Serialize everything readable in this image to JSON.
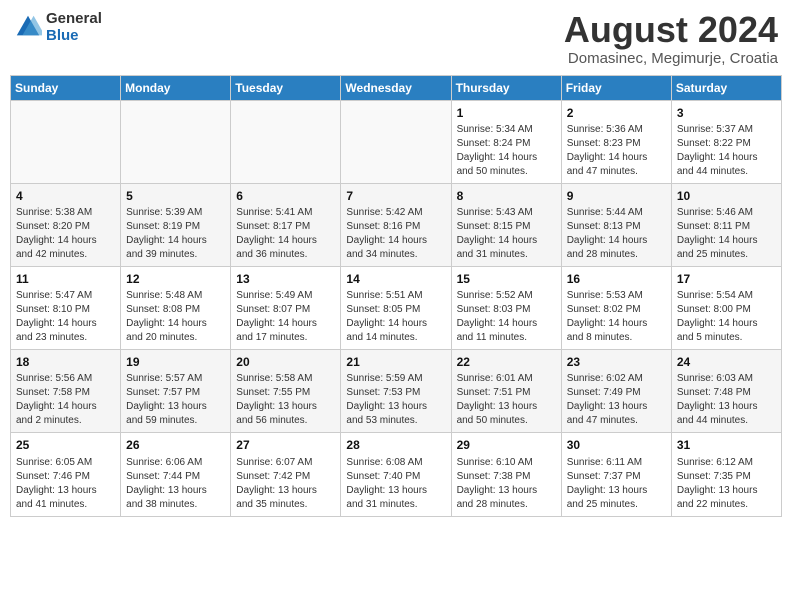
{
  "header": {
    "logo": {
      "general": "General",
      "blue": "Blue"
    },
    "title": "August 2024",
    "subtitle": "Domasinec, Megimurje, Croatia"
  },
  "weekdays": [
    "Sunday",
    "Monday",
    "Tuesday",
    "Wednesday",
    "Thursday",
    "Friday",
    "Saturday"
  ],
  "weeks": [
    [
      {
        "day": "",
        "info": ""
      },
      {
        "day": "",
        "info": ""
      },
      {
        "day": "",
        "info": ""
      },
      {
        "day": "",
        "info": ""
      },
      {
        "day": "1",
        "info": "Sunrise: 5:34 AM\nSunset: 8:24 PM\nDaylight: 14 hours\nand 50 minutes."
      },
      {
        "day": "2",
        "info": "Sunrise: 5:36 AM\nSunset: 8:23 PM\nDaylight: 14 hours\nand 47 minutes."
      },
      {
        "day": "3",
        "info": "Sunrise: 5:37 AM\nSunset: 8:22 PM\nDaylight: 14 hours\nand 44 minutes."
      }
    ],
    [
      {
        "day": "4",
        "info": "Sunrise: 5:38 AM\nSunset: 8:20 PM\nDaylight: 14 hours\nand 42 minutes."
      },
      {
        "day": "5",
        "info": "Sunrise: 5:39 AM\nSunset: 8:19 PM\nDaylight: 14 hours\nand 39 minutes."
      },
      {
        "day": "6",
        "info": "Sunrise: 5:41 AM\nSunset: 8:17 PM\nDaylight: 14 hours\nand 36 minutes."
      },
      {
        "day": "7",
        "info": "Sunrise: 5:42 AM\nSunset: 8:16 PM\nDaylight: 14 hours\nand 34 minutes."
      },
      {
        "day": "8",
        "info": "Sunrise: 5:43 AM\nSunset: 8:15 PM\nDaylight: 14 hours\nand 31 minutes."
      },
      {
        "day": "9",
        "info": "Sunrise: 5:44 AM\nSunset: 8:13 PM\nDaylight: 14 hours\nand 28 minutes."
      },
      {
        "day": "10",
        "info": "Sunrise: 5:46 AM\nSunset: 8:11 PM\nDaylight: 14 hours\nand 25 minutes."
      }
    ],
    [
      {
        "day": "11",
        "info": "Sunrise: 5:47 AM\nSunset: 8:10 PM\nDaylight: 14 hours\nand 23 minutes."
      },
      {
        "day": "12",
        "info": "Sunrise: 5:48 AM\nSunset: 8:08 PM\nDaylight: 14 hours\nand 20 minutes."
      },
      {
        "day": "13",
        "info": "Sunrise: 5:49 AM\nSunset: 8:07 PM\nDaylight: 14 hours\nand 17 minutes."
      },
      {
        "day": "14",
        "info": "Sunrise: 5:51 AM\nSunset: 8:05 PM\nDaylight: 14 hours\nand 14 minutes."
      },
      {
        "day": "15",
        "info": "Sunrise: 5:52 AM\nSunset: 8:03 PM\nDaylight: 14 hours\nand 11 minutes."
      },
      {
        "day": "16",
        "info": "Sunrise: 5:53 AM\nSunset: 8:02 PM\nDaylight: 14 hours\nand 8 minutes."
      },
      {
        "day": "17",
        "info": "Sunrise: 5:54 AM\nSunset: 8:00 PM\nDaylight: 14 hours\nand 5 minutes."
      }
    ],
    [
      {
        "day": "18",
        "info": "Sunrise: 5:56 AM\nSunset: 7:58 PM\nDaylight: 14 hours\nand 2 minutes."
      },
      {
        "day": "19",
        "info": "Sunrise: 5:57 AM\nSunset: 7:57 PM\nDaylight: 13 hours\nand 59 minutes."
      },
      {
        "day": "20",
        "info": "Sunrise: 5:58 AM\nSunset: 7:55 PM\nDaylight: 13 hours\nand 56 minutes."
      },
      {
        "day": "21",
        "info": "Sunrise: 5:59 AM\nSunset: 7:53 PM\nDaylight: 13 hours\nand 53 minutes."
      },
      {
        "day": "22",
        "info": "Sunrise: 6:01 AM\nSunset: 7:51 PM\nDaylight: 13 hours\nand 50 minutes."
      },
      {
        "day": "23",
        "info": "Sunrise: 6:02 AM\nSunset: 7:49 PM\nDaylight: 13 hours\nand 47 minutes."
      },
      {
        "day": "24",
        "info": "Sunrise: 6:03 AM\nSunset: 7:48 PM\nDaylight: 13 hours\nand 44 minutes."
      }
    ],
    [
      {
        "day": "25",
        "info": "Sunrise: 6:05 AM\nSunset: 7:46 PM\nDaylight: 13 hours\nand 41 minutes."
      },
      {
        "day": "26",
        "info": "Sunrise: 6:06 AM\nSunset: 7:44 PM\nDaylight: 13 hours\nand 38 minutes."
      },
      {
        "day": "27",
        "info": "Sunrise: 6:07 AM\nSunset: 7:42 PM\nDaylight: 13 hours\nand 35 minutes."
      },
      {
        "day": "28",
        "info": "Sunrise: 6:08 AM\nSunset: 7:40 PM\nDaylight: 13 hours\nand 31 minutes."
      },
      {
        "day": "29",
        "info": "Sunrise: 6:10 AM\nSunset: 7:38 PM\nDaylight: 13 hours\nand 28 minutes."
      },
      {
        "day": "30",
        "info": "Sunrise: 6:11 AM\nSunset: 7:37 PM\nDaylight: 13 hours\nand 25 minutes."
      },
      {
        "day": "31",
        "info": "Sunrise: 6:12 AM\nSunset: 7:35 PM\nDaylight: 13 hours\nand 22 minutes."
      }
    ]
  ]
}
